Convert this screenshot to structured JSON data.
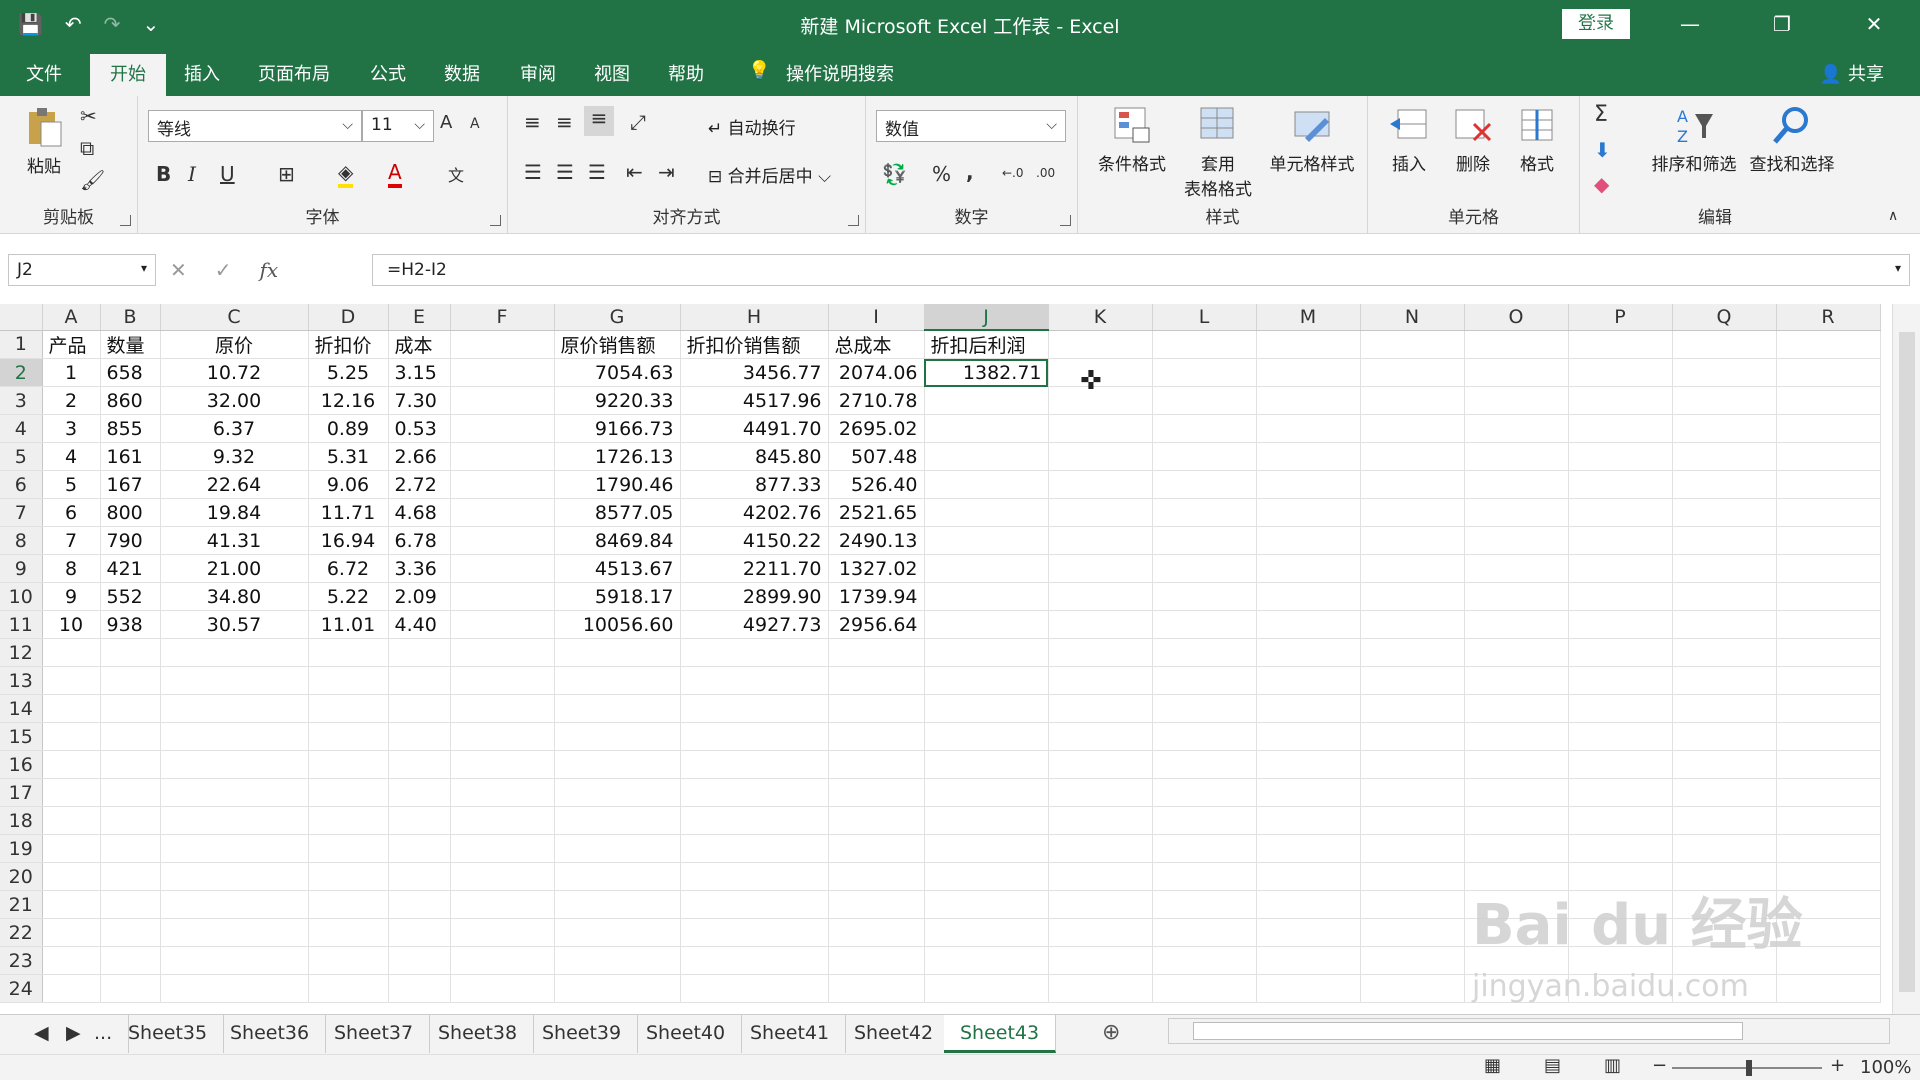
{
  "window": {
    "title": "新建 Microsoft Excel 工作表  -  Excel",
    "login": "登录",
    "minimize": "—",
    "restore": "❐",
    "close": "✕",
    "ribbon_display": "⊡"
  },
  "quick_access": {
    "save": "💾",
    "undo": "↶",
    "redo": "↷",
    "customize": "⌄"
  },
  "tabs": [
    "文件",
    "开始",
    "插入",
    "页面布局",
    "公式",
    "数据",
    "审阅",
    "视图",
    "帮助"
  ],
  "tell_me": "操作说明搜索",
  "share": "共享",
  "ribbon": {
    "clipboard": {
      "label": "剪贴板",
      "paste": "粘贴"
    },
    "font": {
      "label": "字体",
      "name": "等线",
      "size": "11",
      "bold": "B",
      "italic": "I",
      "underline": "U",
      "grow": "A",
      "shrink": "A",
      "wen": "文"
    },
    "alignment": {
      "label": "对齐方式",
      "wrap": "自动换行",
      "merge": "合并后居中"
    },
    "number": {
      "label": "数字",
      "format": "数值",
      "percent": "%",
      "comma": ","
    },
    "styles": {
      "label": "样式",
      "conditional": "条件格式",
      "table_fmt_1": "套用",
      "table_fmt_2": "表格格式",
      "cell_styles": "单元格样式"
    },
    "cells": {
      "label": "单元格",
      "insert": "插入",
      "delete": "删除",
      "format": "格式"
    },
    "editing": {
      "label": "编辑",
      "sort": "排序和筛选",
      "find": "查找和选择",
      "sigma": "Σ"
    }
  },
  "formula_bar": {
    "name_box": "J2",
    "cancel": "✕",
    "enter": "✓",
    "fx": "fx",
    "formula": "=H2-I2"
  },
  "columns": [
    "A",
    "B",
    "C",
    "D",
    "E",
    "F",
    "G",
    "H",
    "I",
    "J",
    "K",
    "L",
    "M",
    "N",
    "O",
    "P",
    "Q",
    "R"
  ],
  "row_numbers": [
    "1",
    "2",
    "3",
    "4",
    "5",
    "6",
    "7",
    "8",
    "9",
    "10",
    "11",
    "12",
    "13",
    "14",
    "15",
    "16",
    "17",
    "18",
    "19",
    "20",
    "21",
    "22",
    "23",
    "24"
  ],
  "header_row": [
    "产品",
    "数量",
    "原价",
    "折扣价",
    "成本",
    "",
    "原价销售额",
    "折扣价销售额",
    "总成本",
    "折扣后利润"
  ],
  "rows": [
    [
      "1",
      "658",
      "10.72",
      "5.25",
      "3.15",
      "",
      "7054.63",
      "3456.77",
      "2074.06",
      "1382.71"
    ],
    [
      "2",
      "860",
      "32.00",
      "12.16",
      "7.30",
      "",
      "9220.33",
      "4517.96",
      "2710.78",
      ""
    ],
    [
      "3",
      "855",
      "6.37",
      "0.89",
      "0.53",
      "",
      "9166.73",
      "4491.70",
      "2695.02",
      ""
    ],
    [
      "4",
      "161",
      "9.32",
      "5.31",
      "2.66",
      "",
      "1726.13",
      "845.80",
      "507.48",
      ""
    ],
    [
      "5",
      "167",
      "22.64",
      "9.06",
      "2.72",
      "",
      "1790.46",
      "877.33",
      "526.40",
      ""
    ],
    [
      "6",
      "800",
      "19.84",
      "11.71",
      "4.68",
      "",
      "8577.05",
      "4202.76",
      "2521.65",
      ""
    ],
    [
      "7",
      "790",
      "41.31",
      "16.94",
      "6.78",
      "",
      "8469.84",
      "4150.22",
      "2490.13",
      ""
    ],
    [
      "8",
      "421",
      "21.00",
      "6.72",
      "3.36",
      "",
      "4513.67",
      "2211.70",
      "1327.02",
      ""
    ],
    [
      "9",
      "552",
      "34.80",
      "5.22",
      "2.09",
      "",
      "5918.17",
      "2899.90",
      "1739.94",
      ""
    ],
    [
      "10",
      "938",
      "30.57",
      "11.01",
      "4.40",
      "",
      "10056.60",
      "4927.73",
      "2956.64",
      ""
    ]
  ],
  "sheet_tabs": {
    "ellipsis": "...",
    "names": [
      "Sheet35",
      "Sheet36",
      "Sheet37",
      "Sheet38",
      "Sheet39",
      "Sheet40",
      "Sheet41",
      "Sheet42",
      "Sheet43"
    ],
    "active": "Sheet43",
    "add": "⊕"
  },
  "status": {
    "zoom": "100%",
    "minus": "−",
    "plus": "+"
  },
  "watermark": {
    "main": "Bai du 经验",
    "sub": "jingyan.baidu.com"
  }
}
